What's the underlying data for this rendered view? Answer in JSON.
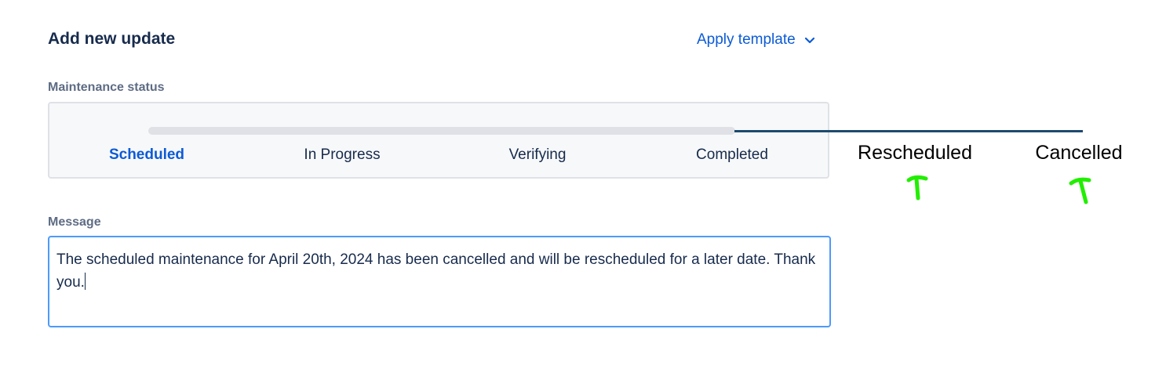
{
  "header": {
    "title": "Add new update",
    "apply_template_label": "Apply template",
    "apply_template_icon": "chevron-down-icon"
  },
  "status": {
    "label": "Maintenance status",
    "steps": [
      {
        "label": "Scheduled",
        "active": true
      },
      {
        "label": "In Progress",
        "active": false
      },
      {
        "label": "Verifying",
        "active": false
      },
      {
        "label": "Completed",
        "active": false
      }
    ],
    "annotation_labels": [
      "Rescheduled",
      "Cancelled"
    ]
  },
  "message": {
    "label": "Message",
    "value": "The scheduled maintenance for April 20th, 2024 has been cancelled and will be rescheduled for a later date. Thank you."
  },
  "colors": {
    "accent": "#0c5bd6",
    "focus_border": "#4c9aff",
    "annotation_arrow": "#22ee00",
    "annotation_line": "#1e4a6e"
  }
}
